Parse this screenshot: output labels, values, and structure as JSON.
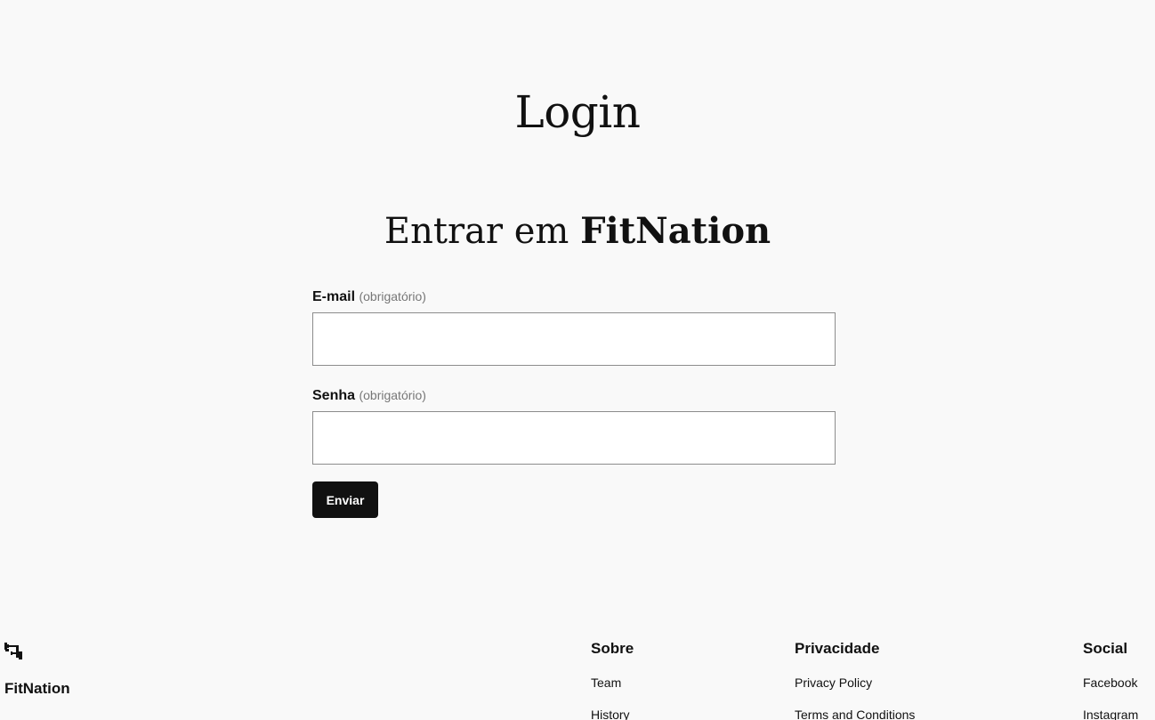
{
  "page": {
    "title": "Login"
  },
  "form": {
    "heading_prefix": "Entrar em",
    "heading_brand": "FitNation",
    "email": {
      "label": "E-mail",
      "required_note": "(obrigatório)",
      "value": "",
      "placeholder": ""
    },
    "password": {
      "label": "Senha",
      "required_note": "(obrigatório)",
      "value": "",
      "placeholder": ""
    },
    "submit_label": "Enviar"
  },
  "footer": {
    "site_name": "FitNation",
    "logo_icon": "dumbbell-logo-icon",
    "columns": [
      {
        "title": "Sobre",
        "links": [
          "Team",
          "History"
        ]
      },
      {
        "title": "Privacidade",
        "links": [
          "Privacy Policy",
          "Terms and Conditions"
        ]
      },
      {
        "title": "Social",
        "links": [
          "Facebook",
          "Instagram"
        ]
      }
    ]
  }
}
